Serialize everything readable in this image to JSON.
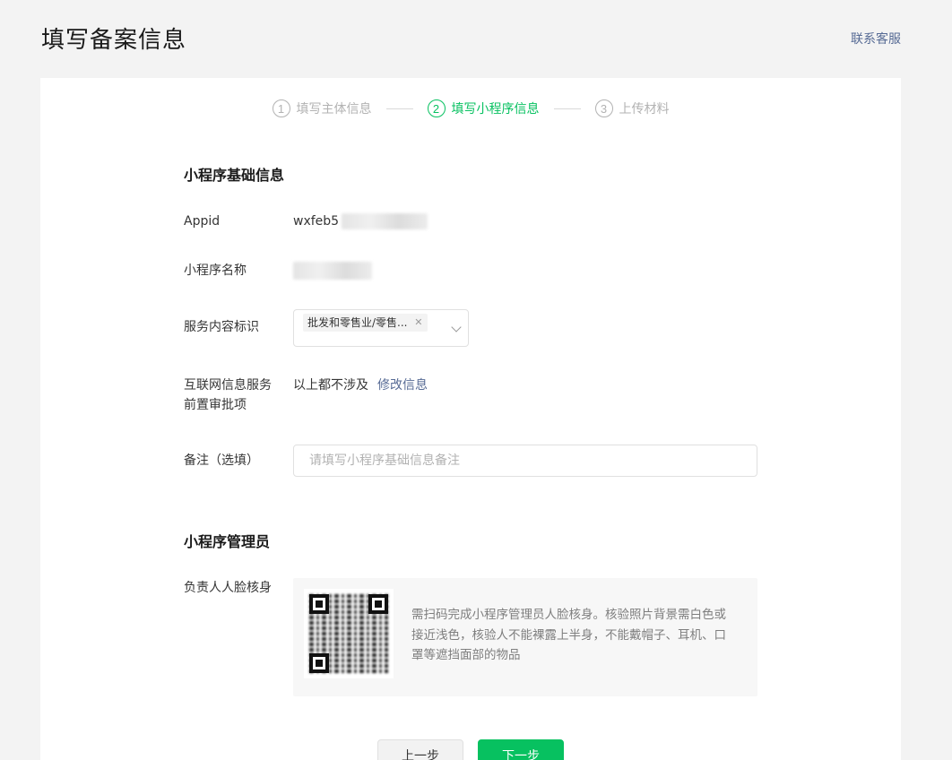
{
  "header": {
    "title": "填写备案信息",
    "support_link": "联系客服"
  },
  "steps": [
    {
      "num": "1",
      "label": "填写主体信息",
      "state": "done"
    },
    {
      "num": "2",
      "label": "填写小程序信息",
      "state": "active"
    },
    {
      "num": "3",
      "label": "上传材料",
      "state": "pending"
    }
  ],
  "basic_info": {
    "section_title": "小程序基础信息",
    "appid_label": "Appid",
    "appid_value": "wxfeb5",
    "name_label": "小程序名称",
    "service_label": "服务内容标识",
    "service_tag": "批发和零售业/零售...",
    "approval_label_line1": "互联网信息服务",
    "approval_label_line2": "前置审批项",
    "approval_value": "以上都不涉及",
    "approval_link": "修改信息",
    "remark_label": "备注（选填）",
    "remark_placeholder": "请填写小程序基础信息备注"
  },
  "admin": {
    "section_title": "小程序管理员",
    "face_label": "负责人人脸核身",
    "instructions": "需扫码完成小程序管理员人脸核身。核验照片背景需白色或接近浅色，核验人不能裸露上半身，不能戴帽子、耳机、口罩等遮挡面部的物品"
  },
  "actions": {
    "prev_label": "上一步",
    "next_label": "下一步"
  },
  "colors": {
    "accent": "#07c160",
    "link": "#576b95",
    "muted": "#b2b2b2"
  }
}
